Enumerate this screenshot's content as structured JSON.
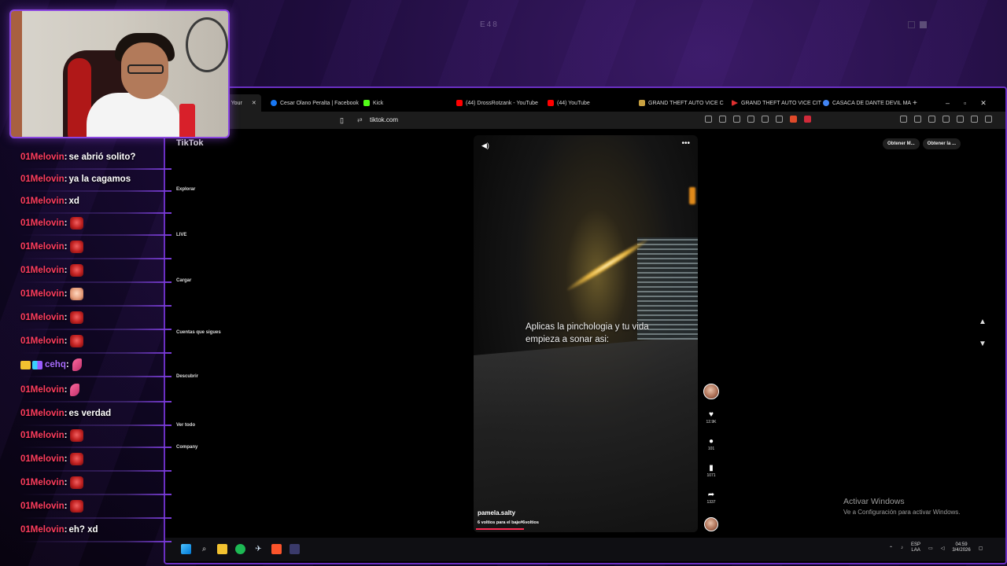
{
  "scene": {
    "tag": "E48"
  },
  "browser": {
    "tabs": [
      {
        "label": "te Your",
        "active": true,
        "icon": "tiktok-icon"
      },
      {
        "label": "Cesar Olano Peralta | Facebook",
        "icon": "facebook-icon",
        "color": "#1877f2"
      },
      {
        "label": "Kick",
        "icon": "kick-icon",
        "color": "#53fc18"
      },
      {
        "label": "(44) DrossRotzank - YouTube",
        "icon": "youtube-icon",
        "color": "#ff0000"
      },
      {
        "label": "(44) YouTube",
        "icon": "youtube-icon",
        "color": "#ff0000"
      },
      {
        "label": "GRAND THEFT AUTO VICE C",
        "icon": "gta-icon",
        "color": "#c8a040"
      },
      {
        "label": "GRAND THEFT AUTO VICE CIT",
        "icon": "play-icon",
        "color": "#e03030"
      },
      {
        "label": "CASACA DE DANTE DEVIL MA",
        "icon": "google-icon",
        "color": "#4285f4"
      }
    ],
    "new_tab": "+",
    "window_controls": {
      "minimize": "–",
      "maximize": "▫",
      "close": "✕"
    },
    "url": "tiktok.com"
  },
  "tiktok": {
    "sidebar": {
      "logo": "TikTok",
      "explore": "Explorar",
      "live": "LIVE",
      "upload": "Cargar",
      "following": "Cuentas que sigues",
      "discover": "Descubrir",
      "see_all": "Ver todo",
      "company": "Company"
    },
    "top_buttons": [
      "Obtener M...",
      "Obtener la ..."
    ],
    "video": {
      "caption": "Aplicas la pinchologia y tu vida empieza a sonar asi:",
      "author": "pamela.salty",
      "description": "6 voltios para el baje#6voltios",
      "progress": 0.22
    },
    "actions": {
      "likes": "12.9K",
      "comments": "101",
      "saves": "1071",
      "shares": "1337"
    }
  },
  "windows": {
    "activate_title": "Activar Windows",
    "activate_sub": "Ve a Configuración para activar Windows.",
    "lang_top": "ESP",
    "lang_bottom": "LAA",
    "time": "04:59",
    "date": "3/4/2026"
  },
  "chat": [
    {
      "user": "01Melovin",
      "text": "se abrió solito?"
    },
    {
      "user": "01Melovin",
      "text": "ya la cagamos"
    },
    {
      "user": "01Melovin",
      "text": "xd"
    },
    {
      "user": "01Melovin",
      "emote": "angry"
    },
    {
      "user": "01Melovin",
      "emote": "angry"
    },
    {
      "user": "01Melovin",
      "emote": "angry"
    },
    {
      "user": "01Melovin",
      "emote": "laugh"
    },
    {
      "user": "01Melovin",
      "emote": "angry"
    },
    {
      "user": "01Melovin",
      "emote": "angry"
    },
    {
      "user": "cehq",
      "emote": "feather",
      "alt": true
    },
    {
      "user": "01Melovin",
      "emote": "feather"
    },
    {
      "user": "01Melovin",
      "text": "es verdad"
    },
    {
      "user": "01Melovin",
      "emote": "angry"
    },
    {
      "user": "01Melovin",
      "emote": "angry"
    },
    {
      "user": "01Melovin",
      "emote": "angry"
    },
    {
      "user": "01Melovin",
      "emote": "angry"
    },
    {
      "user": "01Melovin",
      "text": "eh? xd"
    }
  ]
}
